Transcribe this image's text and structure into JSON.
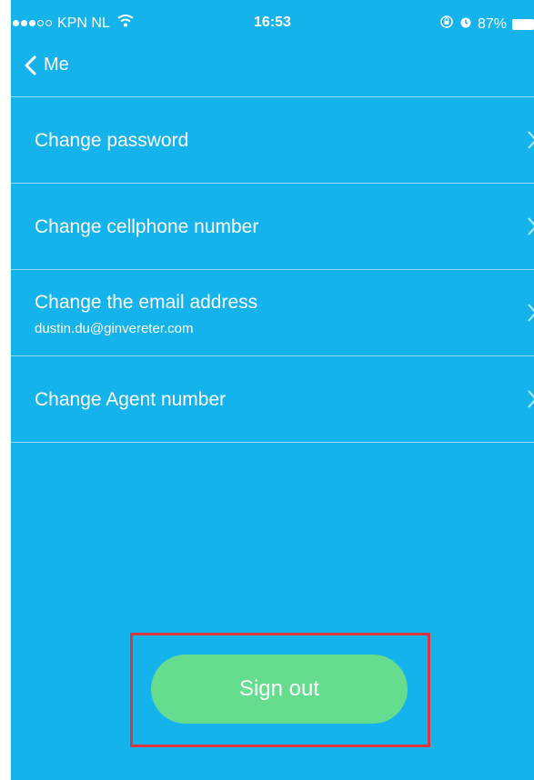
{
  "status_bar": {
    "carrier": "KPN NL",
    "time": "16:53",
    "battery": "87%"
  },
  "nav": {
    "back_label": "Me"
  },
  "menu": [
    {
      "label": "Change password",
      "sub": ""
    },
    {
      "label": "Change cellphone number",
      "sub": ""
    },
    {
      "label": "Change the email address",
      "sub": "dustin.du@ginvereter.com"
    },
    {
      "label": "Change Agent number",
      "sub": ""
    }
  ],
  "signout": {
    "label": "Sign out"
  },
  "colors": {
    "background": "#15b3ec",
    "signout_button": "#65dc8e",
    "highlight_box": "#d9363e"
  }
}
